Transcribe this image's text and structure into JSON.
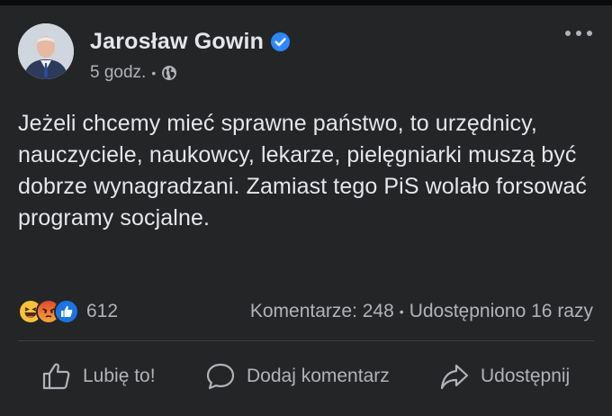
{
  "post": {
    "author": "Jarosław Gowin",
    "time": "5 godz.",
    "separator": "•",
    "text": "Jeżeli chcemy mieć sprawne państwo, to urzędnicy, nauczyciele, naukowcy, lekarze, pielęgniarki muszą być dobrze wynagradzani. Zamiast tego PiS wolało forsować programy socjalne.",
    "audience_icon": "globe-icon",
    "verified_icon": "verified-badge-icon"
  },
  "reactions": {
    "icons": [
      "haha-emoji",
      "angry-emoji",
      "like-emoji"
    ],
    "count": "612"
  },
  "stats": {
    "comments": "Komentarze: 248",
    "separator": "•",
    "shares": "Udostępniono 16 razy"
  },
  "actions": {
    "like": "Lubię to!",
    "comment": "Dodaj komentarz",
    "share": "Udostępnij"
  },
  "colors": {
    "background": "#242526",
    "text_primary": "#e4e6eb",
    "text_secondary": "#b0b3b8",
    "verified_blue": "#2d88ff"
  }
}
